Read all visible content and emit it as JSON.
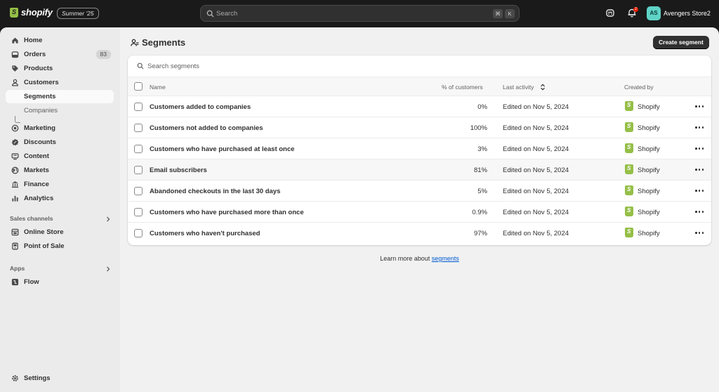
{
  "topbar": {
    "brand": "shopify",
    "edition_badge": "Summer '25",
    "search_placeholder": "Search",
    "shortcut_keys": [
      "⌘",
      "K"
    ],
    "notification_count": "2",
    "avatar_initials": "AS",
    "store_name": "Avengers Store2"
  },
  "sidebar": {
    "items": [
      {
        "label": "Home",
        "icon": "home-icon"
      },
      {
        "label": "Orders",
        "icon": "orders-icon",
        "count": "83"
      },
      {
        "label": "Products",
        "icon": "tag-icon"
      },
      {
        "label": "Customers",
        "icon": "person-icon"
      },
      {
        "label": "Segments",
        "active": true
      },
      {
        "label": "Companies"
      },
      {
        "label": "Marketing",
        "icon": "target-icon"
      },
      {
        "label": "Discounts",
        "icon": "discount-icon"
      },
      {
        "label": "Content",
        "icon": "content-icon"
      },
      {
        "label": "Markets",
        "icon": "globe-icon"
      },
      {
        "label": "Finance",
        "icon": "bank-icon"
      },
      {
        "label": "Analytics",
        "icon": "chart-icon"
      }
    ],
    "sales_channels_label": "Sales channels",
    "sales_channels": [
      {
        "label": "Online Store",
        "icon": "store-icon"
      },
      {
        "label": "Point of Sale",
        "icon": "pos-icon"
      }
    ],
    "apps_label": "Apps",
    "apps": [
      {
        "label": "Flow",
        "icon": "flow-icon"
      }
    ],
    "settings_label": "Settings"
  },
  "page": {
    "title": "Segments",
    "create_button": "Create segment",
    "search_placeholder": "Search segments",
    "columns": {
      "name": "Name",
      "percent": "% of customers",
      "last_activity": "Last activity",
      "created_by": "Created by"
    },
    "rows": [
      {
        "name": "Customers added to companies",
        "percent": "0%",
        "activity": "Edited on Nov 5, 2024",
        "created_by": "Shopify"
      },
      {
        "name": "Customers not added to companies",
        "percent": "100%",
        "activity": "Edited on Nov 5, 2024",
        "created_by": "Shopify"
      },
      {
        "name": "Customers who have purchased at least once",
        "percent": "3%",
        "activity": "Edited on Nov 5, 2024",
        "created_by": "Shopify"
      },
      {
        "name": "Email subscribers",
        "percent": "81%",
        "activity": "Edited on Nov 5, 2024",
        "created_by": "Shopify"
      },
      {
        "name": "Abandoned checkouts in the last 30 days",
        "percent": "5%",
        "activity": "Edited on Nov 5, 2024",
        "created_by": "Shopify"
      },
      {
        "name": "Customers who have purchased more than once",
        "percent": "0.9%",
        "activity": "Edited on Nov 5, 2024",
        "created_by": "Shopify"
      },
      {
        "name": "Customers who haven't purchased",
        "percent": "97%",
        "activity": "Edited on Nov 5, 2024",
        "created_by": "Shopify"
      }
    ],
    "learn_more_prefix": "Learn more about ",
    "learn_more_link": "segments"
  }
}
